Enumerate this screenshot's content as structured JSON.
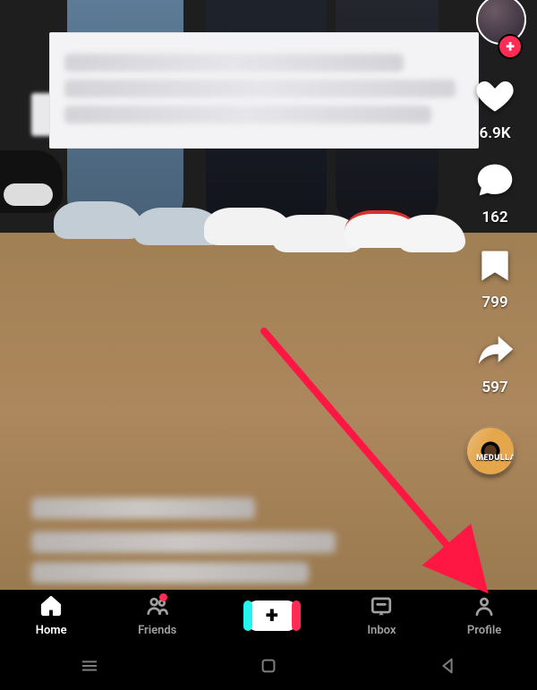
{
  "rail": {
    "like_count": "6.9K",
    "comment_count": "162",
    "bookmark_count": "799",
    "share_count": "597",
    "sound_label": "MEDULLA"
  },
  "tabs": {
    "home": "Home",
    "friends": "Friends",
    "inbox": "Inbox",
    "profile": "Profile"
  },
  "colors": {
    "accent_pink": "#fe2c55",
    "accent_cyan": "#25f4ee",
    "annotation_arrow": "#ff1744"
  }
}
